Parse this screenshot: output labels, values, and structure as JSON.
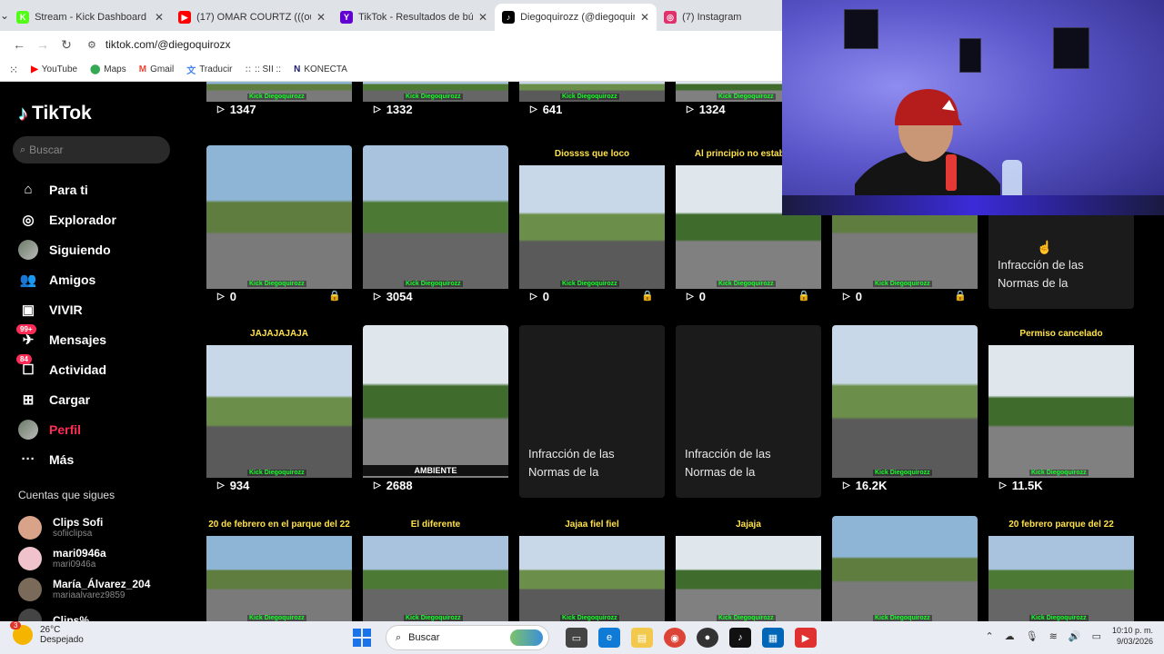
{
  "browser": {
    "tabs": [
      {
        "title": "Stream - Kick Dashboard",
        "fav": "K",
        "color": "#53fc18",
        "active": false
      },
      {
        "title": "(17) OMAR COURTZ (((ou...",
        "fav": "▶",
        "color": "#ff0000",
        "active": false
      },
      {
        "title": "TikTok - Resultados de bús...",
        "fav": "Y",
        "color": "#6001d2",
        "active": false
      },
      {
        "title": "Diegoquirozz (@diegoquiro...",
        "fav": "♪",
        "color": "#000000",
        "active": true
      },
      {
        "title": "(7) Instagram",
        "fav": "◎",
        "color": "#e1306c",
        "active": false
      }
    ],
    "url": "tiktok.com/@diegoquirozx",
    "bookmarks": [
      {
        "label": "YouTube",
        "icon": "▶",
        "color": "#ff0000"
      },
      {
        "label": "Maps",
        "icon": "⬤",
        "color": "#34a853"
      },
      {
        "label": "Gmail",
        "icon": "M",
        "color": "#ea4335"
      },
      {
        "label": "Traducir",
        "icon": "文",
        "color": "#4285f4"
      },
      {
        "label": ":: SII ::",
        "icon": "::",
        "color": "#888888"
      },
      {
        "label": "KONECTA",
        "icon": "N",
        "color": "#1a1a6e"
      }
    ]
  },
  "tiktok": {
    "logo": "TikTok",
    "search_placeholder": "Buscar",
    "nav": [
      {
        "label": "Para ti",
        "icon": "⌂",
        "name": "home-icon"
      },
      {
        "label": "Explorador",
        "icon": "◎",
        "name": "compass-icon"
      },
      {
        "label": "Siguiendo",
        "icon": "",
        "name": "following-avatar-icon"
      },
      {
        "label": "Amigos",
        "icon": "👥",
        "name": "friends-icon"
      },
      {
        "label": "VIVIR",
        "icon": "▣",
        "name": "live-icon"
      },
      {
        "label": "Mensajes",
        "icon": "✈",
        "name": "messages-icon",
        "badge": "99+"
      },
      {
        "label": "Actividad",
        "icon": "☐",
        "name": "activity-icon",
        "badge": "84"
      },
      {
        "label": "Cargar",
        "icon": "⊞",
        "name": "upload-icon"
      },
      {
        "label": "Perfil",
        "icon": "",
        "name": "profile-avatar-icon",
        "active": true
      },
      {
        "label": "Más",
        "icon": "···",
        "name": "more-icon"
      }
    ],
    "following_title": "Cuentas que sigues",
    "following": [
      {
        "name": "Clips Sofi",
        "user": "sofiiclipsa",
        "color": "#d9a38a"
      },
      {
        "name": "mari0946a",
        "user": "mari0946a",
        "color": "#f0c2cc"
      },
      {
        "name": "María_Álvarez_204",
        "user": "mariaalvarez9859",
        "color": "#7a6a5a"
      },
      {
        "name": "Clips%",
        "user": "",
        "color": "#444444"
      }
    ]
  },
  "grid": {
    "removed_text": "Infracción de las Normas de la",
    "watermark": "Kick Diegoquirozz",
    "videos": [
      {
        "views": "1347",
        "caption": "",
        "lock": false
      },
      {
        "views": "1332",
        "caption": "",
        "lock": false
      },
      {
        "views": "641",
        "caption": "",
        "lock": false
      },
      {
        "views": "1324",
        "caption": "",
        "lock": false
      },
      {
        "views": "0",
        "caption": "",
        "lock": true
      },
      {
        "views": "3054",
        "caption": "",
        "lock": false
      },
      {
        "views": "0",
        "caption": "Diossss que loco",
        "lock": true
      },
      {
        "views": "0",
        "caption": "Al principio no estaba se",
        "lock": true
      },
      {
        "views": "0",
        "caption": "",
        "lock": true
      },
      {
        "views": "",
        "caption": "",
        "removed": true
      },
      {
        "views": "934",
        "caption": "JAJAJAJAJA",
        "lock": false
      },
      {
        "views": "2688",
        "caption": "",
        "lock": false
      },
      {
        "views": "",
        "caption": "",
        "removed": true
      },
      {
        "views": "",
        "caption": "",
        "removed": true
      },
      {
        "views": "16.2K",
        "caption": "",
        "lock": false
      },
      {
        "views": "11.5K",
        "caption": "Permiso cancelado",
        "lock": false
      },
      {
        "views": "",
        "caption": "20 de febrero en el parque del 22",
        "lock": false
      },
      {
        "views": "",
        "caption": "El diferente",
        "lock": false
      },
      {
        "views": "",
        "caption": "Jajaa fiel fiel",
        "lock": false
      },
      {
        "views": "",
        "caption": "Jajaja",
        "lock": false
      },
      {
        "views": "",
        "caption": "",
        "lock": false
      },
      {
        "views": "",
        "caption": "20 febrero parque del 22",
        "lock": false
      }
    ],
    "banner_word": "AMBIENTE"
  },
  "taskbar": {
    "weather_temp": "26°C",
    "weather_desc": "Despejado",
    "weather_badge": "3",
    "search_placeholder": "Buscar",
    "time": "10:10 p. m.",
    "date": "9/03/2026"
  }
}
